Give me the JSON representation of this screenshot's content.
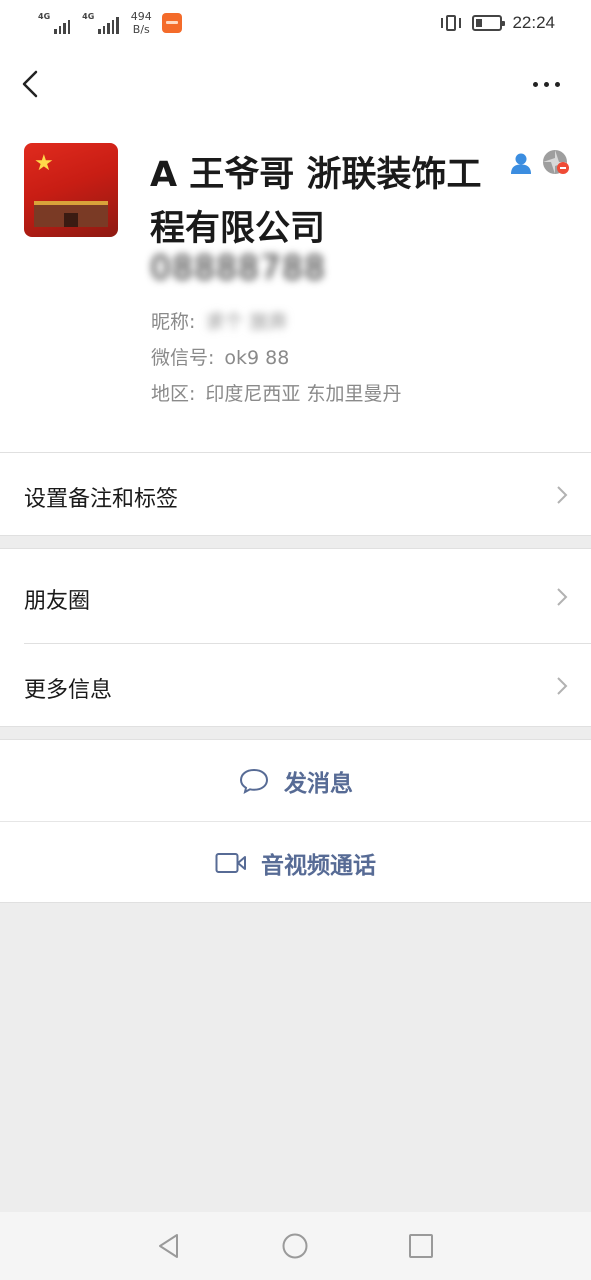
{
  "status_bar": {
    "signal1_label": "4G",
    "signal2_label": "4G",
    "speed_value": "494",
    "speed_unit": "B/s",
    "time": "22:24",
    "battery_level": 0.2
  },
  "nav": {
    "back_icon": "chevron-left-icon",
    "more_icon": "more-icon"
  },
  "profile": {
    "name": "A 王爷哥 浙联装饰工程有限公司",
    "phone": "08888788",
    "nickname_label": "昵称:",
    "nickname_value": "求个 放弃",
    "wechat_id_label": "微信号:",
    "wechat_id_value": "ok9 88",
    "region_label": "地区:",
    "region_value": "印度尼西亚  东加里曼丹"
  },
  "rows": {
    "remark_tags": "设置备注和标签",
    "moments": "朋友圈",
    "more_info": "更多信息"
  },
  "actions": {
    "send_message": "发消息",
    "voice_video_call": "音视频通话"
  },
  "colors": {
    "link": "#576b95",
    "background": "#ededed"
  }
}
